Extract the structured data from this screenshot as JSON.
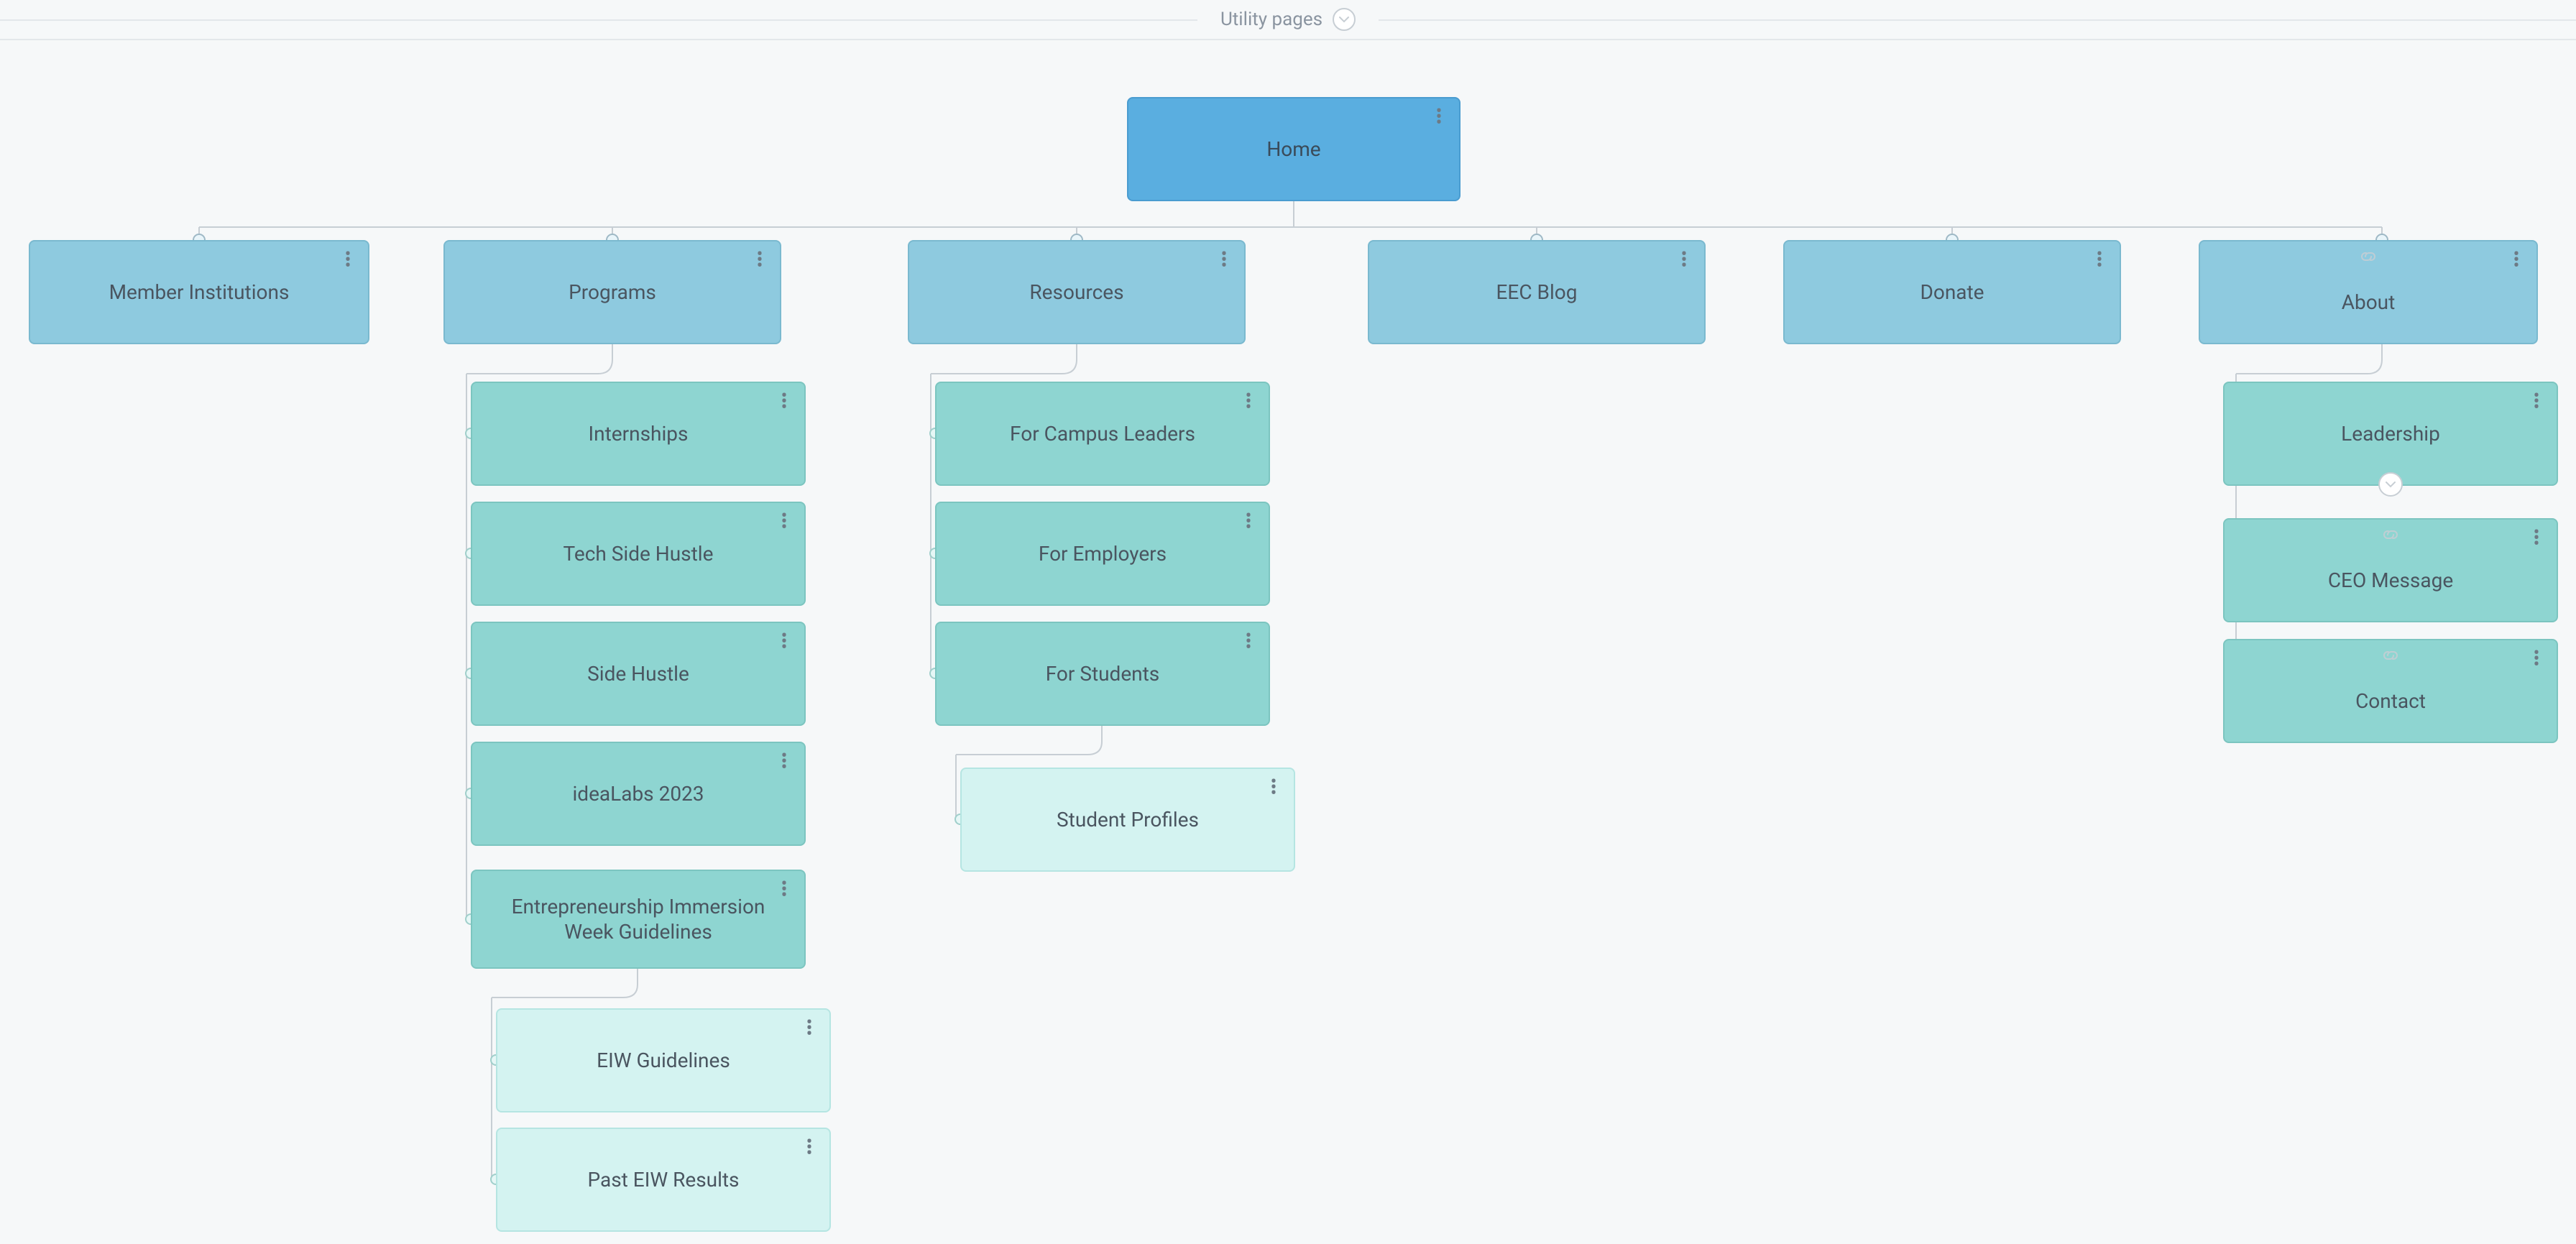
{
  "header": {
    "utility_label": "Utility pages"
  },
  "tree": {
    "root": {
      "label": "Home"
    },
    "branches": [
      {
        "key": "member",
        "label": "Member Institutions",
        "link_icon": false
      },
      {
        "key": "programs",
        "label": "Programs",
        "link_icon": false
      },
      {
        "key": "resources",
        "label": "Resources",
        "link_icon": false
      },
      {
        "key": "blog",
        "label": "EEC Blog",
        "link_icon": false
      },
      {
        "key": "donate",
        "label": "Donate",
        "link_icon": false
      },
      {
        "key": "about",
        "label": "About",
        "link_icon": true
      }
    ],
    "programs_children": [
      {
        "label": "Internships"
      },
      {
        "label": "Tech Side Hustle"
      },
      {
        "label": "Side Hustle"
      },
      {
        "label": "ideaLabs 2023"
      },
      {
        "label": "Entrepreneurship Immersion Week Guidelines"
      }
    ],
    "eiw_children": [
      {
        "label": "EIW Guidelines"
      },
      {
        "label": "Past EIW Results"
      }
    ],
    "resources_children": [
      {
        "label": "For Campus Leaders"
      },
      {
        "label": "For Employers"
      },
      {
        "label": "For Students"
      }
    ],
    "students_children": [
      {
        "label": "Student Profiles"
      }
    ],
    "about_children": [
      {
        "label": "Leadership",
        "link_icon": false,
        "has_expand": true
      },
      {
        "label": "CEO Message",
        "link_icon": true,
        "has_expand": false
      },
      {
        "label": "Contact",
        "link_icon": true,
        "has_expand": false
      }
    ]
  }
}
